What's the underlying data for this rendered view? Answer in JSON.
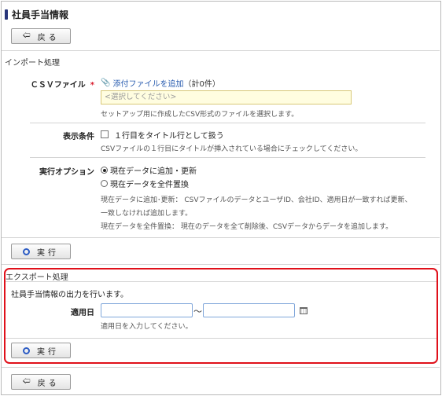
{
  "page": {
    "title": "社員手当情報",
    "back_label": "戻る"
  },
  "import": {
    "section_title": "インポート処理",
    "csv_label": "ＣＳＶファイル",
    "required_mark": "*",
    "attach_link": "添付ファイルを追加",
    "attach_count": "（計0件）",
    "select_placeholder": "<選択してください>",
    "csv_help": "セットアップ用に作成したCSV形式のファイルを選択します。",
    "display_label": "表示条件",
    "title_row_option": "１行目をタイトル行として扱う",
    "title_row_help": "CSVファイルの１行目にタイトルが挿入されている場合にチェックしてください。",
    "exec_option_label": "実行オプション",
    "option_append": "現在データに追加・更新",
    "option_replace": "現在データを全件置換",
    "help_append_1": "現在データに追加･更新： CSVファイルのデータとユーザID、会社ID、適用日が一致すれば更新、",
    "help_append_2": "一致しなければ追加します。",
    "help_replace": "現在データを全件置換： 現在のデータを全て削除後、CSVデータからデータを追加します。",
    "run_label": "実行"
  },
  "export": {
    "section_title": "エクスポート処理",
    "description": "社員手当情報の出力を行います。",
    "date_label": "適用日",
    "range_separator": "～",
    "date_help": "適用日を入力してください。",
    "run_label": "実行"
  },
  "colors": {
    "accent": "#28357a",
    "link": "#2a5db0",
    "required": "#d8182a",
    "highlight_border": "#e0101a",
    "select_bg": "#fffde0"
  },
  "icons": {
    "back": "left-arrow",
    "attach": "paperclip",
    "run": "circle",
    "calendar": "calendar"
  }
}
